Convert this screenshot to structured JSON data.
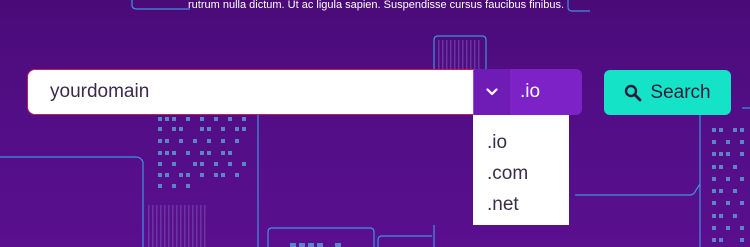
{
  "tagline": "rutrum nulla dictum. Ut ac ligula sapien. Suspendisse cursus faucibus finibus.",
  "search": {
    "value": "yourdomain",
    "button_label": "Search",
    "icon": "search-icon"
  },
  "tld": {
    "selected": ".io",
    "icon": "chevron-down-icon",
    "options": [
      ".io",
      ".com",
      ".net"
    ]
  },
  "colors": {
    "background": "#520e86",
    "select": "#7c22c6",
    "button": "#15e3c8",
    "city_lines": "#3fb6ff"
  }
}
